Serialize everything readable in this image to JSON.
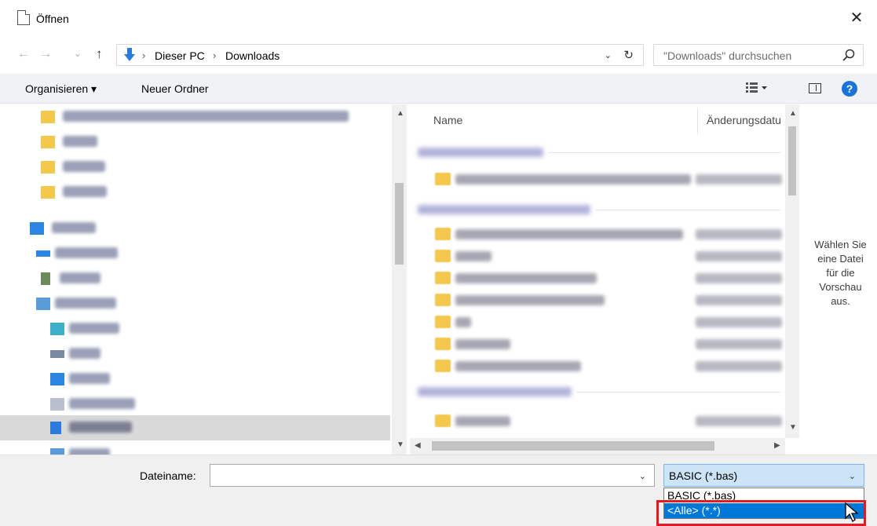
{
  "window": {
    "title": "Öffnen",
    "close_glyph": "✕"
  },
  "address_bar": {
    "back": "←",
    "forward": "→",
    "recent": "⌄",
    "up": "↑",
    "crumbs": [
      "Dieser PC",
      "Downloads"
    ],
    "separator": "›",
    "dropdown": "⌄",
    "refresh": "↻"
  },
  "search": {
    "placeholder": "\"Downloads\" durchsuchen"
  },
  "toolbar": {
    "organize": "Organisieren ▾",
    "new_folder": "Neuer Ordner",
    "view_dropdown": "▾",
    "help": "?"
  },
  "file_list": {
    "col_name": "Name",
    "col_modified": "Änderungsdatu"
  },
  "preview": {
    "message": "Wählen Sie\neine Datei\nfür die\nVorschau\naus."
  },
  "bottom": {
    "filename_label": "Dateiname:",
    "filename_value": "",
    "dropdown_glyph": "⌄",
    "filetype_selected": "BASIC (*.bas)",
    "filetype_options": [
      "BASIC (*.bas)",
      "<Alle> (*.*)"
    ]
  },
  "colors": {
    "accent": "#0078d7",
    "highlight_box": "#e21b22",
    "help_icon": "#1a73d9",
    "folder": "#f4c84c"
  }
}
